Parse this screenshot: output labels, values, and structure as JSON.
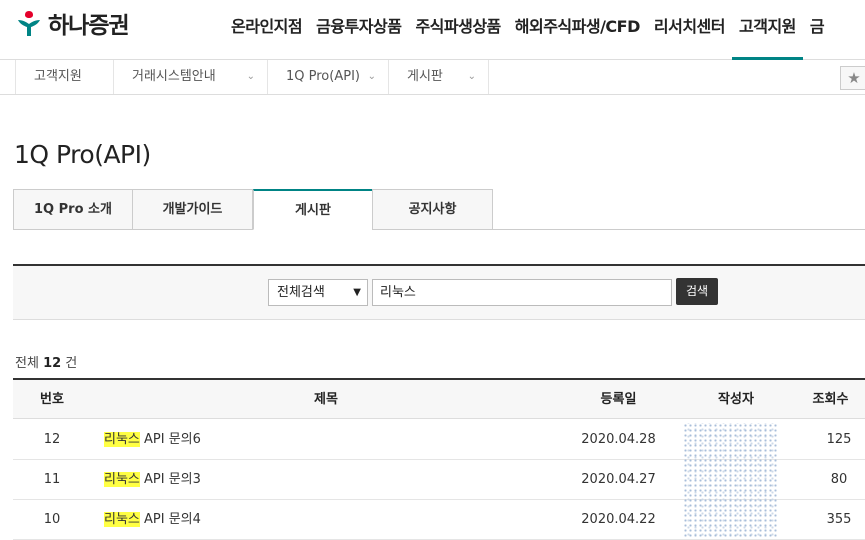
{
  "logo": {
    "text": "하나증권",
    "brand_color": "#008485",
    "accent_color": "#e4002b"
  },
  "nav": {
    "items": [
      "온라인지점",
      "금융투자상품",
      "주식파생상품",
      "해외주식파생/CFD",
      "리서치센터",
      "고객지원",
      "금"
    ],
    "active_index": 5
  },
  "breadcrumb": {
    "items": [
      "고객지원",
      "거래시스템안내",
      "1Q Pro(API)",
      "게시판"
    ],
    "star_icon": "star-icon"
  },
  "page_title": "1Q Pro(API)",
  "tabs": {
    "items": [
      "1Q Pro 소개",
      "개발가이드",
      "게시판",
      "공지사항"
    ],
    "active_index": 2
  },
  "search": {
    "select_value": "전체검색",
    "input_value": "리눅스",
    "button_label": "검색"
  },
  "total": {
    "prefix": "전체",
    "count": "12",
    "suffix": "건"
  },
  "table": {
    "headers": [
      "번호",
      "제목",
      "등록일",
      "작성자",
      "조회수"
    ],
    "rows": [
      {
        "no": "12",
        "highlight": "리눅스",
        "title_rest": " API 문의6",
        "date": "2020.04.28",
        "views": "125"
      },
      {
        "no": "11",
        "highlight": "리눅스",
        "title_rest": " API 문의3",
        "date": "2020.04.27",
        "views": "80"
      },
      {
        "no": "10",
        "highlight": "리눅스",
        "title_rest": " API 문의4",
        "date": "2020.04.22",
        "views": "355"
      }
    ]
  }
}
